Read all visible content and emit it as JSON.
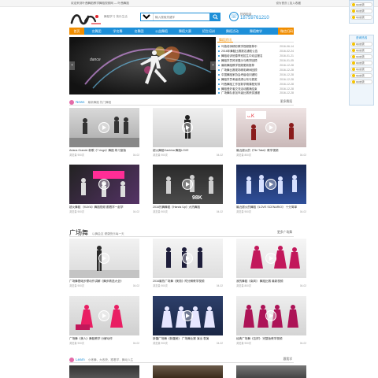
{
  "topbar": {
    "tagline": "欢迎来到叶茜舞蹈教学舞蹈视频网 — 叶茜舞蹈",
    "links": "设为首页 | 加入收藏"
  },
  "header": {
    "logo_text": "叶茜",
    "slogan": "舞蹈学习 快乐生活",
    "search": {
      "category": "视频",
      "placeholder": "输入搜索关键字"
    },
    "hotline": {
      "label": "热线电话",
      "number": "18759761210"
    }
  },
  "nav": {
    "items": [
      "首页",
      "名舞团",
      "学名舞",
      "名舞团",
      "公益舞蹈",
      "舞蹈大赛",
      "招生培训",
      "舞蹈活动",
      "舞蹈教学"
    ],
    "wechat": "微信扫码"
  },
  "side_qq": {
    "group1": [
      "QQ交流",
      "QQ交流",
      "QQ交流"
    ],
    "title2": "咨询热线",
    "group2": [
      "QQ交流",
      "QQ交流",
      "QQ交流",
      "QQ交流",
      "QQ交流",
      "QQ交流",
      "QQ交流"
    ]
  },
  "banner": {
    "caption": "dance"
  },
  "news": {
    "title": "舞蹈资讯",
    "items": [
      {
        "title": "叶茜老师精彩教学视频推荐中",
        "date": "2016-06-14"
      },
      {
        "title": "2016年舞蹈比赛报名通知公告",
        "date": "2016-02-24"
      },
      {
        "title": "舞蹈培训班春季班招生中欢迎报名",
        "date": "2016-01-21"
      },
      {
        "title": "舞蹈学员风采展示与教学回顾",
        "date": "2016-01-05"
      },
      {
        "title": "最新舞蹈教学视频更新推荐",
        "date": "2016-12-28"
      },
      {
        "title": "广场舞比赛现场精彩瞬间回顾",
        "date": "2016-12-28"
      },
      {
        "title": "中国舞蹈家协会考级培训通知",
        "date": "2016-12-28"
      },
      {
        "title": "舞蹈学员考级成绩公布与颁奖",
        "date": "2016-12-28"
      },
      {
        "title": "叶茜舞蹈工作室新学期课程安排",
        "date": "2016-12-28"
      },
      {
        "title": "舞蹈爱好者交流活动圆满结束",
        "date": "2016-12-28"
      },
      {
        "title": "广场舞队参加市级比赛获奖通报",
        "date": "2016-12-28"
      }
    ]
  },
  "section_news": {
    "title": "News",
    "subtitle": "最新舞蹈 热门舞蹈",
    "more": "更多舞蹈",
    "cards": [
      {
        "caption": "Ariana Grande 新歌《7 rings》舞蹈 练习室版",
        "views": "浏览量 900次",
        "date": "04-02"
      },
      {
        "caption": "超火舞蹈Gashina 舞蹈LOVE",
        "views": "浏览量 900次",
        "date": "04-02"
      },
      {
        "caption": "最近超火的《Tiki Taka》教学视频",
        "views": "浏览量 800次",
        "date": "04-02"
      },
      {
        "caption": "超火舞蹈 《KAYA》舞蹈视频 跟着学一起学",
        "views": "浏览量 900次",
        "date": "04-02"
      },
      {
        "caption": "2016热舞舞蹈《Hands Up》大热舞蹈",
        "views": "浏览量 900次",
        "date": "04-02"
      },
      {
        "caption": "最近超火的舞蹈《LOVE SCENARIO》 十分简单",
        "views": "浏览量 900次",
        "date": "04-02"
      }
    ]
  },
  "section_square": {
    "title": "广场舞",
    "subtitle": "以舞会友 健康快乐每一天",
    "more": "更多广场舞",
    "cards": [
      {
        "caption": "广场舞基础步骤动作讲解《舞步精选大全》",
        "views": "浏览量 900次",
        "date": "04-02"
      },
      {
        "caption": "2016最热广场舞《美丽》附分解教学视频",
        "views": "浏览量 900次",
        "date": "04-02"
      },
      {
        "caption": "我的舞蹈《南风》 舞蹈比赛 最新视频",
        "views": "浏览量 800次",
        "date": "04-02"
      },
      {
        "caption": "广场舞《美人》舞蹈教学 分解动作",
        "views": "浏览量 900次",
        "date": "04-02"
      },
      {
        "caption": "新疆广场舞《新疆美》 广场舞比赛 演出 表演",
        "views": "浏览量 900次",
        "date": "04-02"
      },
      {
        "caption": "经典广场舞《吉祥》 完整版教学视频",
        "views": "浏览量 900次",
        "date": "04-02"
      }
    ]
  },
  "section_learn": {
    "title": "Learn",
    "subtitle": "小练舞，大收获，跟着学，舞动人生",
    "more": "跟我学"
  }
}
